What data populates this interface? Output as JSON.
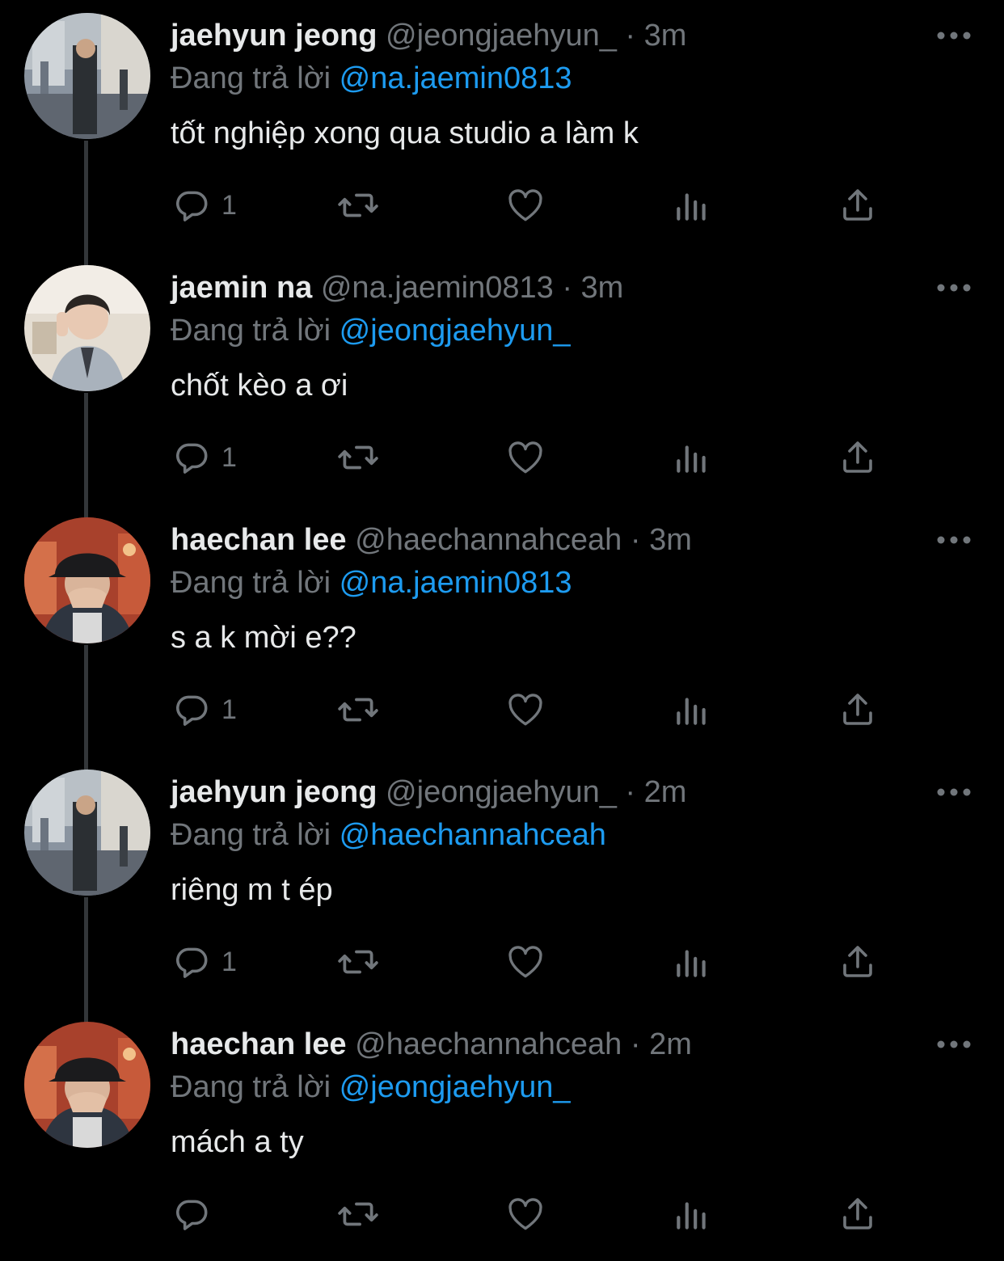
{
  "colors": {
    "background": "#000000",
    "text": "#e7e9ea",
    "muted": "#71767b",
    "accent": "#1d9bf0",
    "thread_line": "#333639"
  },
  "icons": {
    "reply": "reply-icon",
    "retweet": "retweet-icon",
    "like": "heart-icon",
    "views": "analytics-icon",
    "share": "share-icon",
    "more": "more-icon"
  },
  "thread": [
    {
      "name": "jaehyun jeong",
      "handle": "@jeongjaehyun_",
      "time": "3m",
      "replying_label": "Đang trả lời",
      "replying_to": "@na.jaemin0813",
      "text": "tốt nghiệp xong qua studio a làm k",
      "reply_count": "1"
    },
    {
      "name": "jaemin na",
      "handle": "@na.jaemin0813",
      "time": "3m",
      "replying_label": "Đang trả lời",
      "replying_to": "@jeongjaehyun_",
      "text": "chốt kèo a ơi",
      "reply_count": "1"
    },
    {
      "name": "haechan lee",
      "handle": "@haechannahceah",
      "time": "3m",
      "replying_label": "Đang trả lời",
      "replying_to": "@na.jaemin0813",
      "text": "s a k mời e??",
      "reply_count": "1"
    },
    {
      "name": "jaehyun jeong",
      "handle": "@jeongjaehyun_",
      "time": "2m",
      "replying_label": "Đang trả lời",
      "replying_to": "@haechannahceah",
      "text": "riêng m t ép",
      "reply_count": "1"
    },
    {
      "name": "haechan lee",
      "handle": "@haechannahceah",
      "time": "2m",
      "replying_label": "Đang trả lời",
      "replying_to": "@jeongjaehyun_",
      "text": "mách a ty",
      "reply_count": ""
    }
  ]
}
